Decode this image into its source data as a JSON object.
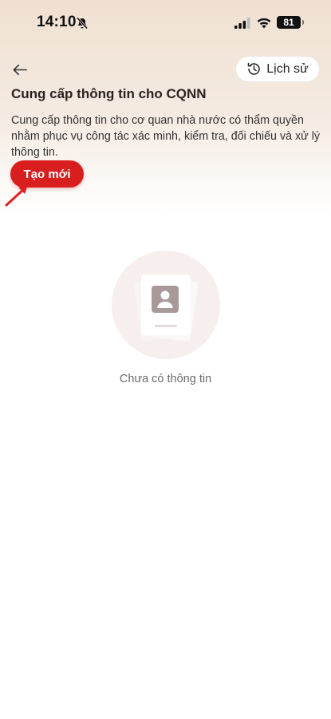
{
  "status_bar": {
    "time": "14:10",
    "battery": "81",
    "icons": [
      "bell-off-icon",
      "signal-icon",
      "wifi-icon",
      "battery-icon"
    ]
  },
  "header": {
    "back_icon": "arrow-left-icon",
    "history_label": "Lịch sử",
    "history_icon": "history-clock-icon",
    "title": "Cung cấp thông tin cho CQNN",
    "description": "Cung cấp thông tin cho cơ quan nhà nước có thẩm quyền nhằm phục vụ công tác xác minh, kiểm tra, đối chiếu và xử lý thông tin."
  },
  "actions": {
    "create_label": "Tạo mới"
  },
  "empty_state": {
    "icon": "profile-card-icon",
    "text": "Chưa có thông tin"
  },
  "colors": {
    "accent": "#d81e1e",
    "gradient_top": "#efe0d1",
    "annotation_arrow": "#e02020"
  }
}
